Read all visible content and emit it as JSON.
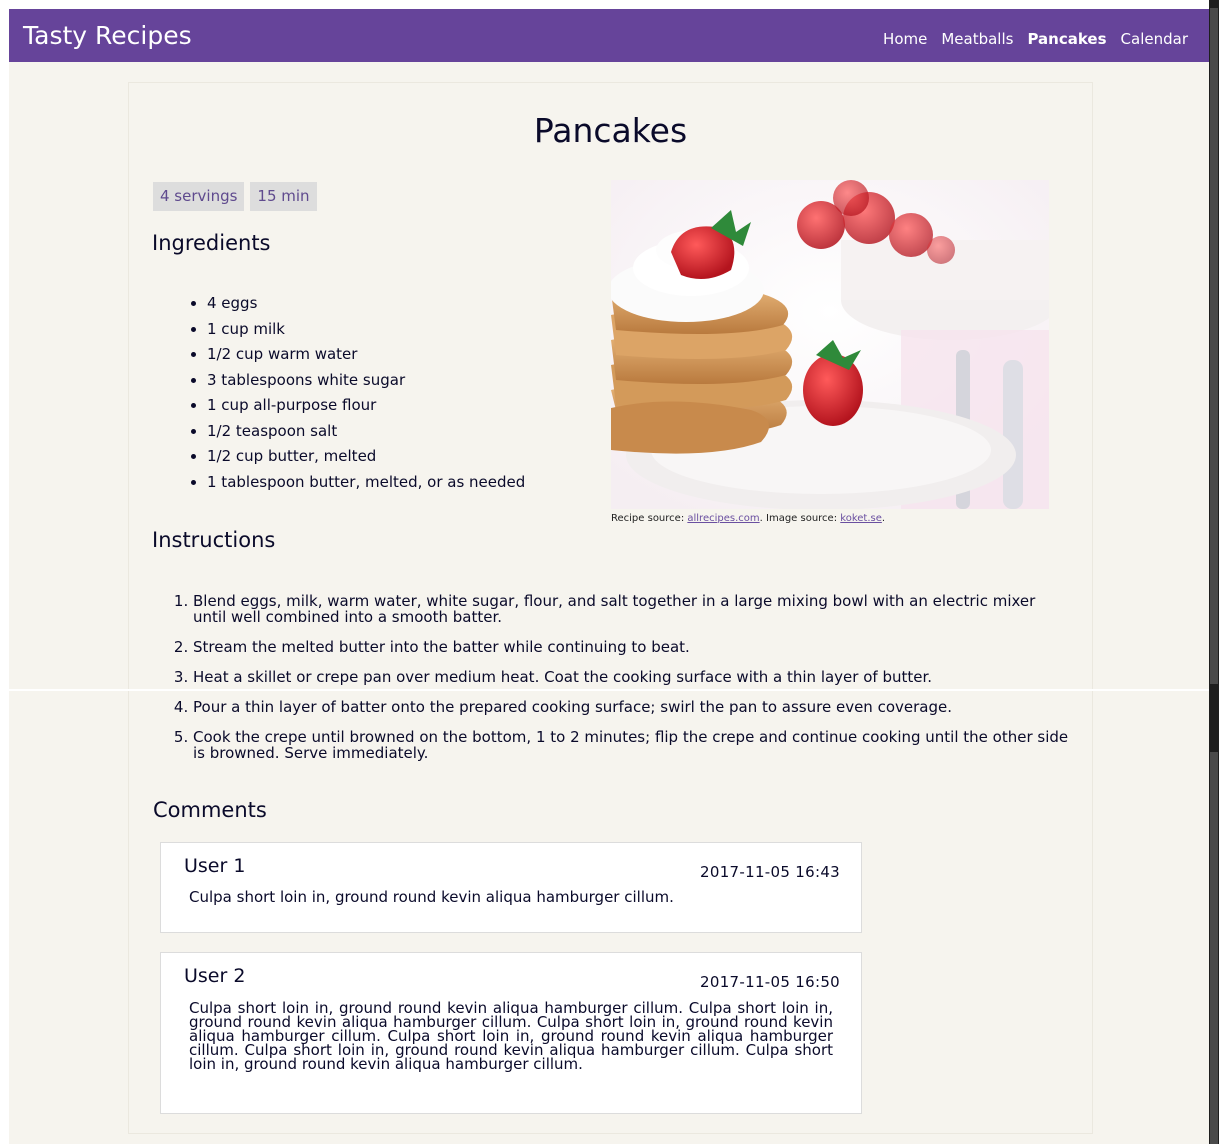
{
  "header": {
    "brand": "Tasty Recipes",
    "nav": [
      {
        "label": "Home",
        "active": false
      },
      {
        "label": "Meatballs",
        "active": false
      },
      {
        "label": "Pancakes",
        "active": true
      },
      {
        "label": "Calendar",
        "active": false
      }
    ],
    "background_color": "#66449a"
  },
  "recipe": {
    "title": "Pancakes",
    "tags": [
      "4 servings",
      "15 min"
    ],
    "ingredients_heading": "Ingredients",
    "ingredients": [
      "4 eggs",
      "1 cup milk",
      "1/2 cup warm water",
      "3 tablespoons white sugar",
      "1 cup all-purpose flour",
      "1/2 teaspoon salt",
      "1/2 cup butter, melted",
      "1 tablespoon butter, melted, or as needed"
    ],
    "image_caption": {
      "recipe_source_label": "Recipe source: ",
      "recipe_source_link": "allrecipes.com",
      "image_source_label": ". Image source: ",
      "image_source_link": "koket.se",
      "end": "."
    },
    "instructions_heading": "Instructions",
    "instructions": [
      "Blend eggs, milk, warm water, white sugar, flour, and salt together in a large mixing bowl with an electric mixer until well combined into a smooth batter.",
      "Stream the melted butter into the batter while continuing to beat.",
      "Heat a skillet or crepe pan over medium heat. Coat the cooking surface with a thin layer of butter.",
      "Pour a thin layer of batter onto the prepared cooking surface; swirl the pan to assure even coverage.",
      "Cook the crepe until browned on the bottom, 1 to 2 minutes; flip the crepe and continue cooking until the other side is browned. Serve immediately."
    ]
  },
  "comments": {
    "heading": "Comments",
    "items": [
      {
        "user": "User 1",
        "time": "2017-11-05 16:43",
        "text": "Culpa short loin in, ground round kevin aliqua hamburger cillum."
      },
      {
        "user": "User 2",
        "time": "2017-11-05 16:50",
        "text": "Culpa short loin in, ground round kevin aliqua hamburger cillum. Culpa short loin in, ground round kevin aliqua hamburger cillum. Culpa short loin in, ground round kevin aliqua hamburger cillum. Culpa short loin in, ground round kevin aliqua hamburger cillum. Culpa short loin in, ground round kevin aliqua hamburger cillum. Culpa short loin in, ground round kevin aliqua hamburger cillum."
      }
    ]
  },
  "colors": {
    "page_background": "#f6f4ee",
    "tag_background": "#dddddd",
    "tag_text": "#5f4a8e",
    "link": "#6a4fa0",
    "text": "#0a0a2a"
  }
}
